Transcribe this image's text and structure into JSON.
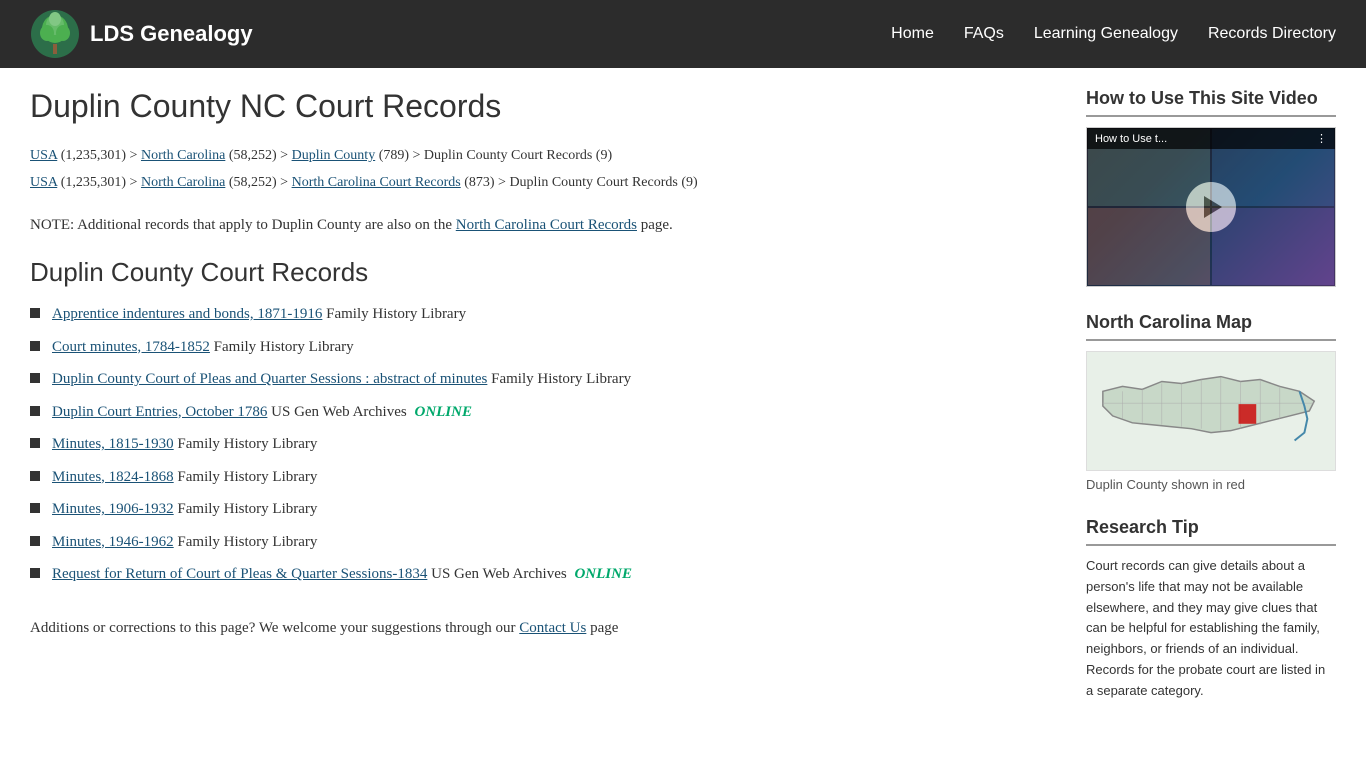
{
  "header": {
    "logo_text": "LDS Genealogy",
    "nav": {
      "home": "Home",
      "faqs": "FAQs",
      "learning": "Learning Genealogy",
      "records_dir": "Records Directory"
    }
  },
  "main": {
    "page_title": "Duplin County NC Court Records",
    "breadcrumbs": [
      {
        "items": [
          {
            "text": "USA",
            "href": true
          },
          {
            "text": " (1,235,301) > ",
            "href": false
          },
          {
            "text": "North Carolina",
            "href": true
          },
          {
            "text": " (58,252) > ",
            "href": false
          },
          {
            "text": "Duplin County",
            "href": true
          },
          {
            "text": " (789) > Duplin County Court Records (9)",
            "href": false
          }
        ]
      },
      {
        "items": [
          {
            "text": "USA",
            "href": true
          },
          {
            "text": " (1,235,301) > ",
            "href": false
          },
          {
            "text": "North Carolina",
            "href": true
          },
          {
            "text": " (58,252) > ",
            "href": false
          },
          {
            "text": "North Carolina Court Records",
            "href": true
          },
          {
            "text": " (873) > Duplin County Court Records (9)",
            "href": false
          }
        ]
      }
    ],
    "note": {
      "prefix": "NOTE: Additional records that apply to Duplin County are also on the ",
      "link_text": "North Carolina Court Records",
      "suffix": " page."
    },
    "records_heading": "Duplin County Court Records",
    "records": [
      {
        "link": "Apprentice indentures and bonds, 1871-1916",
        "suffix": " Family History Library",
        "online": false
      },
      {
        "link": "Court minutes, 1784-1852",
        "suffix": " Family History Library",
        "online": false
      },
      {
        "link": "Duplin County Court of Pleas and Quarter Sessions : abstract of minutes",
        "suffix": " Family History Library",
        "online": false
      },
      {
        "link": "Duplin Court Entries, October 1786",
        "suffix": " US Gen Web Archives ",
        "online": true,
        "online_text": "ONLINE"
      },
      {
        "link": "Minutes, 1815-1930",
        "suffix": " Family History Library",
        "online": false
      },
      {
        "link": "Minutes, 1824-1868",
        "suffix": " Family History Library",
        "online": false
      },
      {
        "link": "Minutes, 1906-1932",
        "suffix": " Family History Library",
        "online": false
      },
      {
        "link": "Minutes, 1946-1962",
        "suffix": " Family History Library",
        "online": false
      },
      {
        "link": "Request for Return of Court of Pleas & Quarter Sessions-1834",
        "suffix": " US Gen Web Archives ",
        "online": true,
        "online_text": "ONLINE"
      }
    ],
    "additions": {
      "prefix": "Additions or corrections to this page? We welcome your suggestions through our ",
      "link_text": "Contact Us",
      "suffix": " page"
    }
  },
  "sidebar": {
    "video_section": {
      "heading": "How to Use This Site Video",
      "title_overlay": "How to Use t...",
      "menu_dots": "⋮"
    },
    "map_section": {
      "heading": "North Carolina Map",
      "caption": "Duplin County shown in red"
    },
    "tip_section": {
      "heading": "Research Tip",
      "text": "Court records can give details about a person's life that may not be available elsewhere, and they may give clues that can be helpful for establishing the family, neighbors, or friends of an individual.  Records for the probate court are listed in a separate category."
    }
  }
}
